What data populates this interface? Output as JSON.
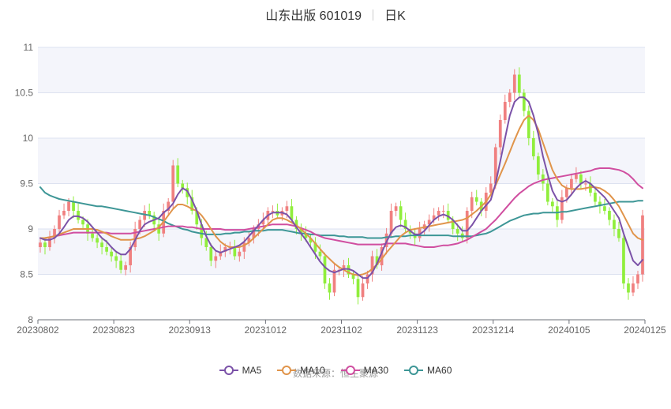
{
  "header": {
    "title": "山东出版 601019",
    "period": "日K"
  },
  "source_text": "数据来源：恒生聚源",
  "colors": {
    "up": "#f08080",
    "down": "#90ee3c",
    "ma5": "#7b52a8",
    "ma10": "#e0944a",
    "ma30": "#d04ea0",
    "ma60": "#3d9696",
    "band": "#f4f5fb",
    "grid": "#dde2f0"
  },
  "chart_data": {
    "type": "candlestick",
    "x_ticks": [
      "20230802",
      "20230823",
      "20230913",
      "20231012",
      "20231102",
      "20231123",
      "20231214",
      "20240105",
      "20240125"
    ],
    "y_ticks": [
      "11",
      "10.5",
      "10",
      "9.5",
      "9",
      "8.5",
      "8"
    ],
    "ylim": [
      8,
      11
    ],
    "legend": [
      "MA5",
      "MA10",
      "MA30",
      "MA60"
    ],
    "grid": true,
    "close": [
      8.85,
      8.8,
      8.9,
      9.0,
      9.15,
      9.2,
      9.3,
      9.2,
      9.1,
      9.05,
      8.95,
      8.9,
      8.85,
      8.8,
      8.75,
      8.7,
      8.65,
      8.55,
      8.6,
      8.8,
      9.0,
      9.1,
      9.2,
      9.15,
      9.05,
      8.95,
      9.2,
      9.3,
      9.7,
      9.5,
      9.45,
      9.35,
      9.2,
      9.05,
      8.9,
      8.8,
      8.65,
      8.7,
      8.75,
      8.8,
      8.8,
      8.7,
      8.75,
      8.85,
      8.9,
      9.0,
      9.05,
      9.1,
      9.2,
      9.2,
      9.15,
      9.2,
      9.25,
      9.1,
      9.0,
      8.95,
      8.9,
      8.85,
      8.75,
      8.7,
      8.4,
      8.3,
      8.55,
      8.55,
      8.6,
      8.5,
      8.45,
      8.25,
      8.4,
      8.5,
      8.7,
      8.6,
      8.8,
      8.95,
      9.2,
      9.25,
      9.1,
      9.0,
      8.95,
      8.9,
      9.0,
      9.05,
      9.1,
      9.15,
      9.2,
      9.2,
      9.1,
      9.0,
      8.95,
      8.9,
      9.2,
      9.35,
      9.3,
      9.2,
      9.4,
      9.5,
      9.9,
      10.2,
      10.4,
      10.5,
      10.7,
      10.5,
      10.3,
      10.0,
      9.8,
      9.6,
      9.5,
      9.3,
      9.25,
      9.1,
      9.35,
      9.45,
      9.55,
      9.6,
      9.5,
      9.5,
      9.4,
      9.3,
      9.25,
      9.2,
      9.1,
      9.0,
      8.9,
      8.4,
      8.3,
      8.4,
      8.5,
      9.15
    ],
    "ma5": [
      8.9,
      8.88,
      8.88,
      8.9,
      8.95,
      9.02,
      9.1,
      9.14,
      9.14,
      9.12,
      9.08,
      9.02,
      8.96,
      8.9,
      8.86,
      8.8,
      8.75,
      8.72,
      8.72,
      8.78,
      8.88,
      8.98,
      9.05,
      9.08,
      9.1,
      9.12,
      9.18,
      9.22,
      9.28,
      9.38,
      9.45,
      9.42,
      9.32,
      9.2,
      9.05,
      8.92,
      8.82,
      8.76,
      8.74,
      8.76,
      8.78,
      8.8,
      8.82,
      8.86,
      8.92,
      8.98,
      9.04,
      9.1,
      9.15,
      9.18,
      9.18,
      9.18,
      9.16,
      9.1,
      9.02,
      8.95,
      8.88,
      8.8,
      8.72,
      8.64,
      8.58,
      8.54,
      8.52,
      8.54,
      8.56,
      8.56,
      8.54,
      8.5,
      8.46,
      8.46,
      8.52,
      8.62,
      8.74,
      8.86,
      8.96,
      9.02,
      9.04,
      9.02,
      8.98,
      8.94,
      8.94,
      8.98,
      9.04,
      9.1,
      9.14,
      9.16,
      9.14,
      9.1,
      9.04,
      8.98,
      8.98,
      9.04,
      9.12,
      9.2,
      9.26,
      9.32,
      9.5,
      9.75,
      10.0,
      10.25,
      10.4,
      10.45,
      10.45,
      10.4,
      10.25,
      10.05,
      9.8,
      9.6,
      9.42,
      9.32,
      9.3,
      9.32,
      9.38,
      9.45,
      9.5,
      9.53,
      9.5,
      9.45,
      9.4,
      9.35,
      9.28,
      9.2,
      9.12,
      8.95,
      8.8,
      8.65,
      8.6,
      8.66
    ],
    "ma10": [
      8.9,
      8.9,
      8.91,
      8.92,
      8.94,
      8.96,
      8.98,
      9.0,
      9.0,
      9.0,
      9.0,
      9.0,
      8.99,
      8.97,
      8.95,
      8.92,
      8.9,
      8.88,
      8.88,
      8.88,
      8.89,
      8.9,
      8.92,
      8.95,
      8.98,
      9.02,
      9.08,
      9.15,
      9.22,
      9.27,
      9.27,
      9.25,
      9.22,
      9.2,
      9.15,
      9.08,
      9.0,
      8.92,
      8.86,
      8.82,
      8.8,
      8.8,
      8.8,
      8.82,
      8.85,
      8.9,
      8.95,
      9.0,
      9.05,
      9.1,
      9.12,
      9.12,
      9.1,
      9.07,
      9.04,
      9.0,
      8.95,
      8.9,
      8.84,
      8.78,
      8.72,
      8.67,
      8.62,
      8.58,
      8.55,
      8.52,
      8.5,
      8.49,
      8.5,
      8.52,
      8.56,
      8.61,
      8.67,
      8.74,
      8.8,
      8.86,
      8.92,
      8.96,
      8.99,
      9.0,
      9.01,
      9.02,
      9.03,
      9.04,
      9.05,
      9.06,
      9.07,
      9.08,
      9.09,
      9.1,
      9.12,
      9.16,
      9.2,
      9.25,
      9.3,
      9.38,
      9.48,
      9.6,
      9.72,
      9.85,
      9.98,
      10.1,
      10.2,
      10.25,
      10.2,
      10.1,
      9.95,
      9.8,
      9.65,
      9.55,
      9.48,
      9.45,
      9.44,
      9.44,
      9.44,
      9.45,
      9.46,
      9.46,
      9.45,
      9.42,
      9.38,
      9.32,
      9.25,
      9.15,
      9.05,
      8.95,
      8.9,
      8.88
    ],
    "ma30": [
      8.9,
      8.9,
      8.91,
      8.92,
      8.93,
      8.94,
      8.95,
      8.96,
      8.96,
      8.96,
      8.96,
      8.96,
      8.96,
      8.96,
      8.96,
      8.95,
      8.95,
      8.95,
      8.95,
      8.95,
      8.96,
      8.97,
      8.98,
      8.99,
      9.0,
      9.01,
      9.02,
      9.03,
      9.03,
      9.03,
      9.03,
      9.02,
      9.02,
      9.01,
      9.0,
      9.0,
      9.0,
      9.0,
      9.0,
      8.99,
      8.99,
      8.99,
      8.99,
      8.99,
      9.0,
      9.01,
      9.02,
      9.03,
      9.04,
      9.05,
      9.05,
      9.05,
      9.05,
      9.04,
      9.03,
      9.01,
      8.99,
      8.97,
      8.94,
      8.92,
      8.9,
      8.89,
      8.88,
      8.87,
      8.86,
      8.85,
      8.84,
      8.83,
      8.83,
      8.83,
      8.83,
      8.83,
      8.83,
      8.84,
      8.84,
      8.84,
      8.84,
      8.84,
      8.83,
      8.82,
      8.81,
      8.8,
      8.8,
      8.8,
      8.81,
      8.82,
      8.82,
      8.83,
      8.84,
      8.86,
      8.88,
      8.91,
      8.94,
      8.97,
      9.0,
      9.05,
      9.1,
      9.16,
      9.22,
      9.28,
      9.34,
      9.39,
      9.43,
      9.47,
      9.5,
      9.52,
      9.54,
      9.55,
      9.56,
      9.57,
      9.58,
      9.59,
      9.6,
      9.61,
      9.62,
      9.63,
      9.64,
      9.66,
      9.67,
      9.67,
      9.67,
      9.66,
      9.65,
      9.63,
      9.6,
      9.55,
      9.49,
      9.45
    ],
    "ma60": [
      9.46,
      9.4,
      9.37,
      9.35,
      9.33,
      9.32,
      9.31,
      9.3,
      9.29,
      9.28,
      9.27,
      9.26,
      9.25,
      9.25,
      9.24,
      9.23,
      9.22,
      9.21,
      9.2,
      9.19,
      9.18,
      9.17,
      9.16,
      9.15,
      9.13,
      9.11,
      9.09,
      9.06,
      9.04,
      9.02,
      9.0,
      8.99,
      8.97,
      8.96,
      8.95,
      8.94,
      8.94,
      8.94,
      8.94,
      8.95,
      8.95,
      8.96,
      8.96,
      8.97,
      8.97,
      8.98,
      8.98,
      8.98,
      8.99,
      8.99,
      8.99,
      8.99,
      8.98,
      8.97,
      8.96,
      8.95,
      8.95,
      8.94,
      8.94,
      8.93,
      8.93,
      8.93,
      8.93,
      8.92,
      8.92,
      8.91,
      8.91,
      8.91,
      8.91,
      8.9,
      8.9,
      8.9,
      8.9,
      8.91,
      8.91,
      8.92,
      8.92,
      8.92,
      8.93,
      8.93,
      8.93,
      8.93,
      8.93,
      8.93,
      8.93,
      8.93,
      8.93,
      8.92,
      8.92,
      8.92,
      8.92,
      8.92,
      8.93,
      8.94,
      8.95,
      8.97,
      9.0,
      9.03,
      9.06,
      9.09,
      9.11,
      9.13,
      9.15,
      9.16,
      9.17,
      9.17,
      9.18,
      9.18,
      9.18,
      9.18,
      9.19,
      9.19,
      9.2,
      9.21,
      9.22,
      9.23,
      9.24,
      9.25,
      9.26,
      9.27,
      9.28,
      9.29,
      9.3,
      9.3,
      9.3,
      9.3,
      9.31,
      9.31
    ]
  }
}
